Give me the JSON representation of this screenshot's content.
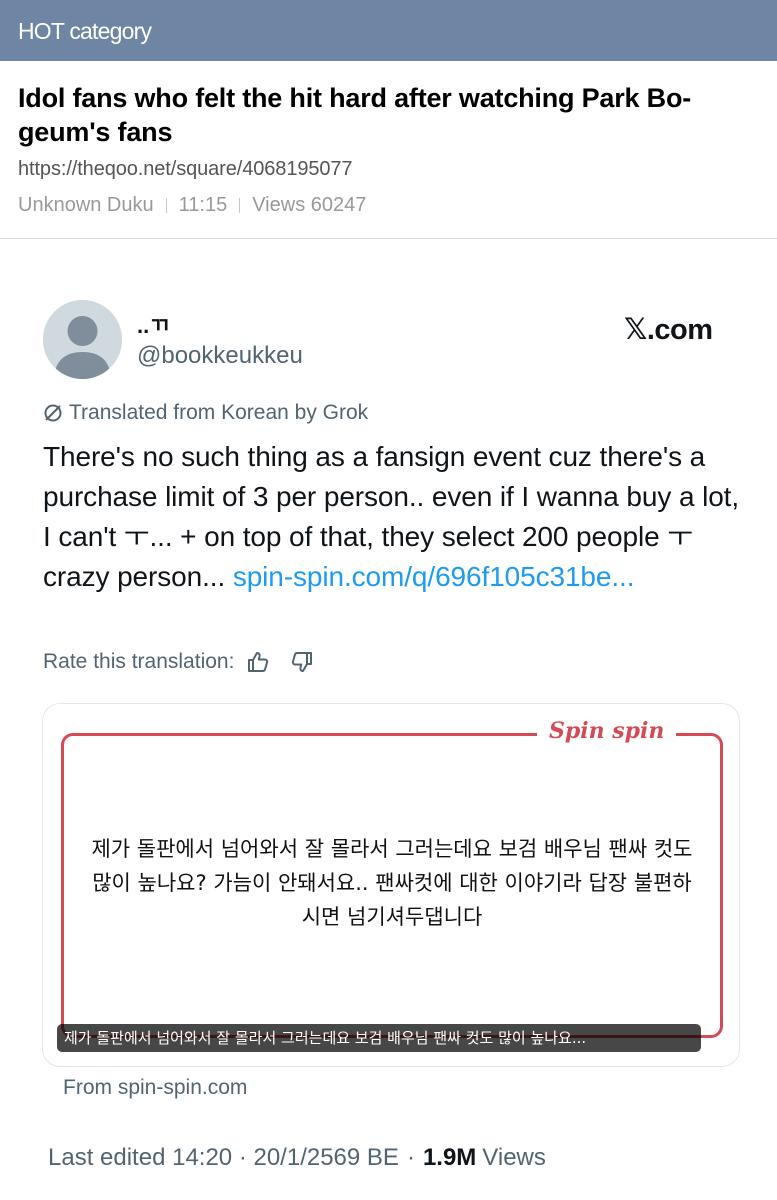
{
  "header": {
    "title": "HOT category"
  },
  "article": {
    "title": "Idol fans who felt the hit hard after watching Park Bo-geum's fans",
    "url": "https://theqoo.net/square/4068195077",
    "author": "Unknown Duku",
    "time": "11:15",
    "views": "Views 60247"
  },
  "tweet": {
    "display_name": "..ㄲ",
    "handle": "@bookkeukkeu",
    "source_logo": "𝕏.com",
    "translated_label": "Translated from Korean by Grok",
    "text": "There's no such thing as a fansign event cuz there's a purchase limit of 3 per person.. even if I wanna buy a lot, I can't ㅜ... + on top of that, they select 200 people ㅜ crazy person... ",
    "link": "spin-spin.com/q/696f105c31be...",
    "rate_label": "Rate this translation:",
    "icons": {
      "translate": "translate-icon",
      "thumbs_up": "thumbs-up-icon",
      "thumbs_down": "thumbs-down-icon"
    }
  },
  "card": {
    "logo": "Spin spin",
    "question": "제가 돌판에서 넘어와서 잘 몰라서 그러는데요 보검 배우님 팬싸 컷도 많이 높나요? 가늠이 안돼서요.. 팬싸컷에 대한 이야기라 답장 불편하시면 넘기셔두댑니다",
    "caption": "제가 돌판에서 넘어와서 잘 몰라서 그러는데요 보검 배우님 팬싸 컷도 많이 높나요...",
    "source": "From spin-spin.com",
    "accent_color": "#d44a55"
  },
  "footer": {
    "edited": "Last edited 14:20 · 20/1/2569 BE",
    "dot": "·",
    "views_count": "1.9M",
    "views_label": "Views"
  },
  "colors": {
    "topbar": "#6f85a4",
    "link": "#1d9bf0",
    "muted": "#536471"
  }
}
